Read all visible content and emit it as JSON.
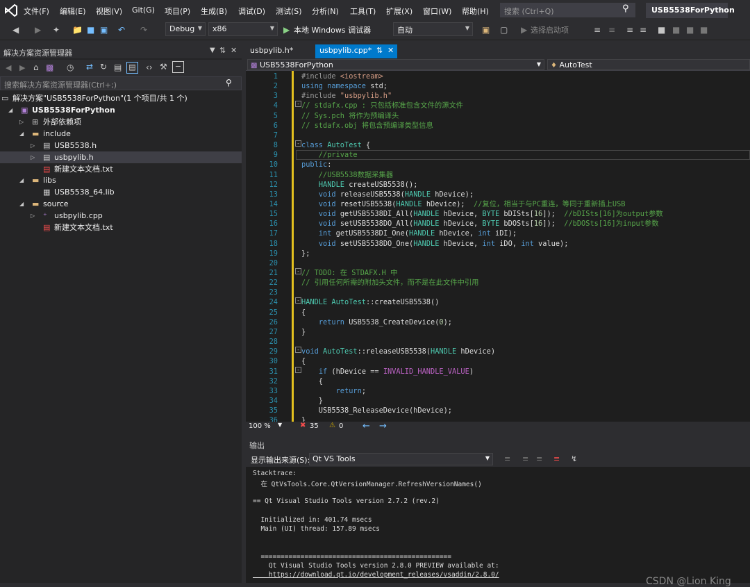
{
  "menu": {
    "items": [
      "文件(F)",
      "编辑(E)",
      "视图(V)",
      "Git(G)",
      "项目(P)",
      "生成(B)",
      "调试(D)",
      "测试(S)",
      "分析(N)",
      "工具(T)",
      "扩展(X)",
      "窗口(W)",
      "帮助(H)"
    ],
    "search_placeholder": "搜索 (Ctrl+Q)",
    "project_title": "USB5538ForPython"
  },
  "toolbar": {
    "config": "Debug",
    "platform": "x86",
    "run_label": "本地 Windows 调试器",
    "run_target": "自动",
    "startup_label": "选择启动项"
  },
  "solution_explorer": {
    "title": "解决方案资源管理器",
    "search_placeholder": "搜索解决方案资源管理器(Ctrl+;)",
    "rows": [
      {
        "label": "解决方案\"USB5538ForPython\"(1 个项目/共 1 个)",
        "icon": "solution-icon"
      },
      {
        "label": "USB5538ForPython",
        "icon": "project-icon"
      },
      {
        "label": "外部依赖项",
        "icon": "dependencies-icon"
      },
      {
        "label": "include",
        "icon": "folder-icon"
      },
      {
        "label": "USB5538.h",
        "icon": "header-file-icon"
      },
      {
        "label": "usbpylib.h",
        "icon": "header-file-icon"
      },
      {
        "label": "新建文本文档.txt",
        "icon": "text-file-icon"
      },
      {
        "label": "libs",
        "icon": "folder-icon"
      },
      {
        "label": "USB5538_64.lib",
        "icon": "lib-file-icon"
      },
      {
        "label": "source",
        "icon": "folder-icon"
      },
      {
        "label": "usbpylib.cpp",
        "icon": "cpp-file-icon"
      },
      {
        "label": "新建文本文档.txt",
        "icon": "text-file-icon"
      }
    ]
  },
  "tabs": {
    "inactive": "usbpylib.h*",
    "active": "usbpylib.cpp*"
  },
  "editor_nav": {
    "project": "USB5538ForPython",
    "scope": "AutoTest"
  },
  "code_lines": [
    "#include <iostream>",
    "using namespace std;",
    "#include \"usbpylib.h\"",
    "// stdafx.cpp : 只包括标准包含文件的源文件",
    "// Sys.pch 将作为预编译头",
    "// stdafx.obj 将包含预编译类型信息",
    "",
    "class AutoTest {",
    "    //private",
    "public:",
    "    //USB5538数据采集器",
    "    HANDLE createUSB5538();",
    "    void releaseUSB5538(HANDLE hDevice);",
    "    void resetUSB5538(HANDLE hDevice);  //复位，相当于与PC重连，等同于重新插上USB",
    "    void getUSB5538DI_All(HANDLE hDevice, BYTE bDISts[16]);  //bDISts[16]为output参数",
    "    void setUSB5538DO_All(HANDLE hDevice, BYTE bDOSts[16]);  //bDOSts[16]为input参数",
    "    int getUSB5538DI_One(HANDLE hDevice, int iDI);",
    "    void setUSB5538DO_One(HANDLE hDevice, int iDO, int value);",
    "};",
    "",
    "// TODO: 在 STDAFX.H 中",
    "// 引用任何所需的附加头文件，而不是在此文件中引用",
    "",
    "HANDLE AutoTest::createUSB5538()",
    "{",
    "    return USB5538_CreateDevice(0);",
    "}",
    "",
    "void AutoTest::releaseUSB5538(HANDLE hDevice)",
    "{",
    "    if (hDevice == INVALID_HANDLE_VALUE)",
    "    {",
    "        return;",
    "    }",
    "    USB5538_ReleaseDevice(hDevice);",
    "}"
  ],
  "status": {
    "zoom": "100 %",
    "errors": "35",
    "warnings": "0"
  },
  "output": {
    "title": "输出",
    "source_label": "显示输出来源(S):",
    "source_value": "Qt VS Tools",
    "lines": [
      "Stacktrace:",
      "  在 QtVsTools.Core.QtVersionManager.RefreshVersionNames()",
      "",
      "== Qt Visual Studio Tools version 2.7.2 (rev.2)",
      "",
      "  Initialized in: 401.74 msecs",
      "  Main (UI) thread: 157.89 msecs",
      "",
      "",
      "  ================================================",
      "    Qt Visual Studio Tools version 2.8.0 PREVIEW available at:",
      "    https://download.qt.io/development_releases/vsaddin/2.8.0/",
      "  ================================================"
    ]
  },
  "watermark": "CSDN @Lion King"
}
